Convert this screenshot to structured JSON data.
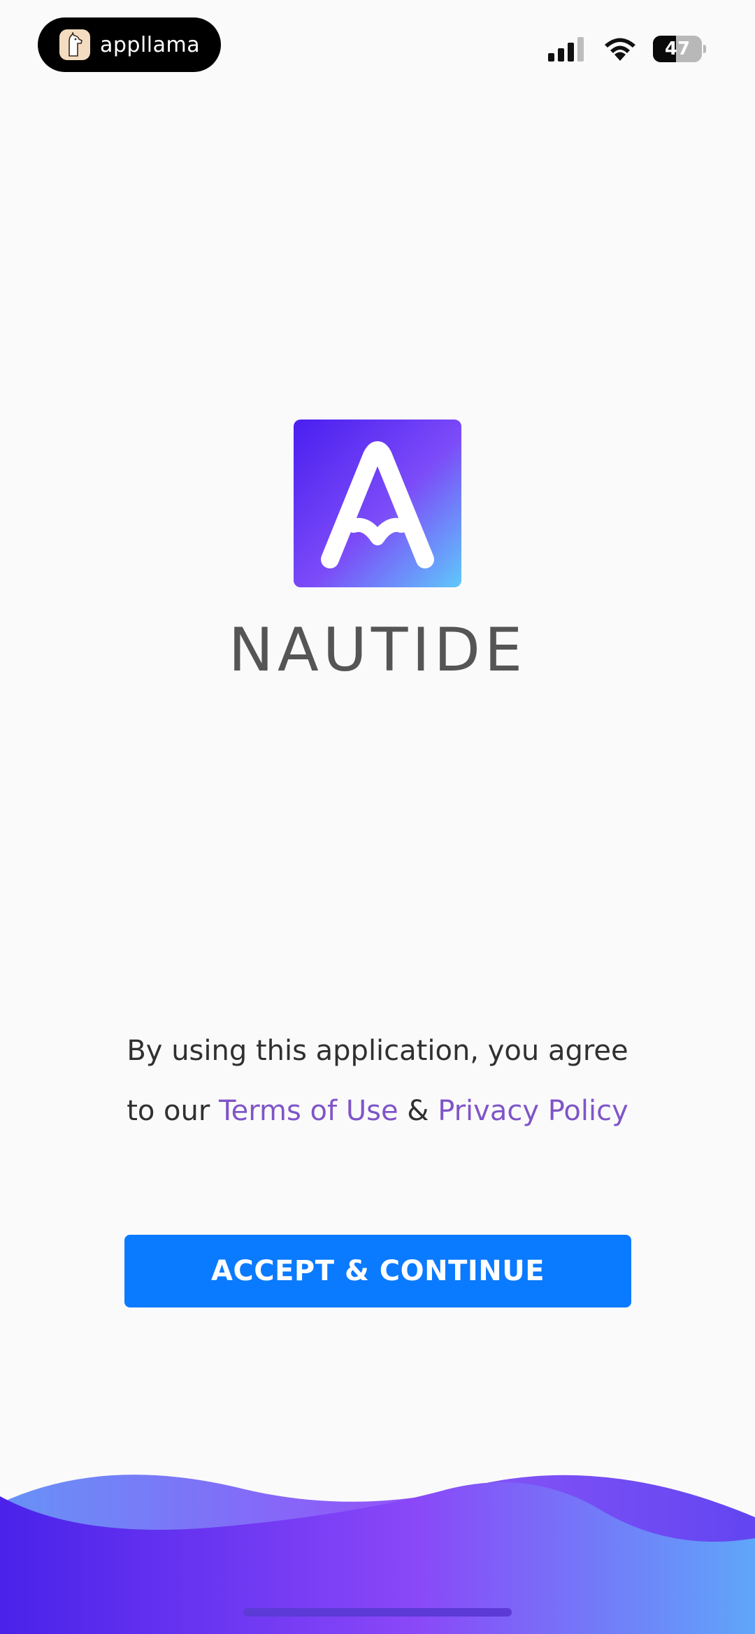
{
  "status_bar": {
    "source_label": "appllama",
    "battery_level": "47",
    "battery_fraction": 0.47
  },
  "brand": {
    "name": "NAUTIDE",
    "logo_icon": "nautide-a-logo-icon",
    "gradient_colors": [
      "#4a1ef0",
      "#7c4cf8",
      "#5fc8fb"
    ]
  },
  "agreement": {
    "line1": "By using this application, you agree",
    "line2_prefix": "to our ",
    "terms_link": "Terms of Use",
    "separator": " & ",
    "privacy_link": "Privacy Policy",
    "link_color": "#7f55c8"
  },
  "actions": {
    "accept_label": "ACCEPT & CONTINUE",
    "accept_color": "#0a7aff"
  }
}
